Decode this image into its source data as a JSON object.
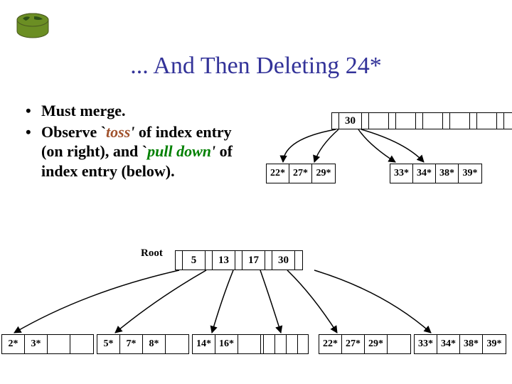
{
  "header": {
    "title": "... And Then Deleting 24*"
  },
  "bullets": [
    {
      "text": "Must merge."
    },
    {
      "parts": [
        "Observe `",
        {
          "cls": "toss",
          "t": "toss"
        },
        {
          "cls": "quote",
          "t": "'"
        },
        " of index entry (on right), and `",
        {
          "cls": "pull",
          "t": "pull down"
        },
        {
          "cls": "quote",
          "t": "'"
        },
        " of index entry (below)."
      ]
    }
  ],
  "upper": {
    "internal": {
      "keys": [
        "30"
      ],
      "empties_after": 7
    },
    "leaves": [
      [
        "22*",
        "27*",
        "29*"
      ],
      [
        "33*",
        "34*",
        "38*",
        "39*"
      ]
    ]
  },
  "lower": {
    "root_label": "Root",
    "internal": {
      "keys": [
        "5",
        "13",
        "17",
        "30"
      ]
    },
    "leaves": [
      [
        "2*",
        "3*",
        "",
        ""
      ],
      [
        "5*",
        "7*",
        "8*",
        ""
      ],
      [
        "14*",
        "16*",
        "",
        ""
      ],
      [
        "",
        "",
        "",
        ""
      ],
      [
        "22*",
        "27*",
        "29*",
        ""
      ],
      [
        "33*",
        "34*",
        "38*",
        "39*"
      ]
    ]
  },
  "colors": {
    "title": "#333399",
    "toss": "#A0522D",
    "pull": "#008000"
  }
}
